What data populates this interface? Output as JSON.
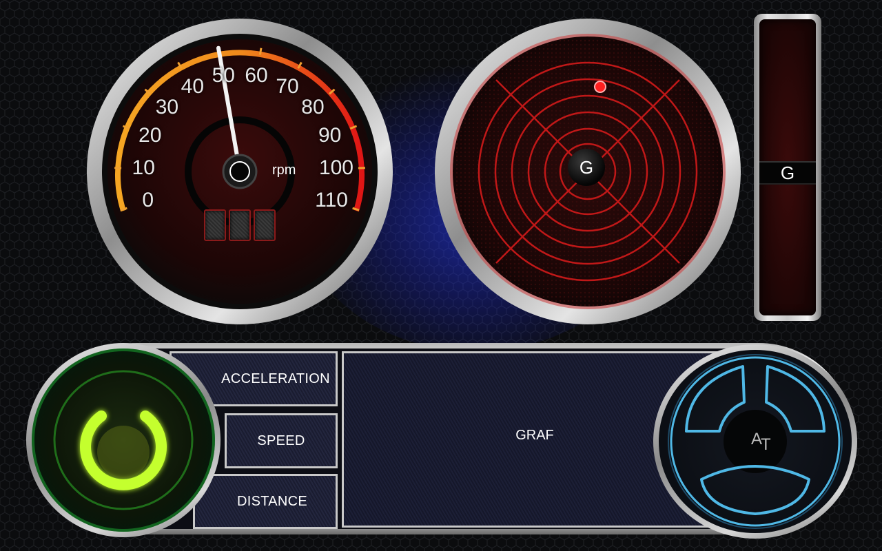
{
  "speedometer": {
    "ticks": [
      "0",
      "10",
      "20",
      "30",
      "40",
      "50",
      "60",
      "70",
      "80",
      "90",
      "100",
      "110"
    ],
    "unit": "rpm",
    "needle_value": 50
  },
  "g_radar": {
    "center_label": "G"
  },
  "g_bar": {
    "label": "G"
  },
  "modes": {
    "acceleration": "ACCELERATION",
    "speed": "SPEED",
    "distance": "DISTANCE"
  },
  "graph": {
    "label": "GRAF"
  },
  "steering": {
    "label_a": "A",
    "label_t": "T"
  },
  "colors": {
    "accent_red": "#e01515",
    "arc_orange": "#f39a1f",
    "power_green": "#b7ff2a",
    "steer_blue": "#4fb8e6",
    "hex_blue": "#2a3dff"
  }
}
